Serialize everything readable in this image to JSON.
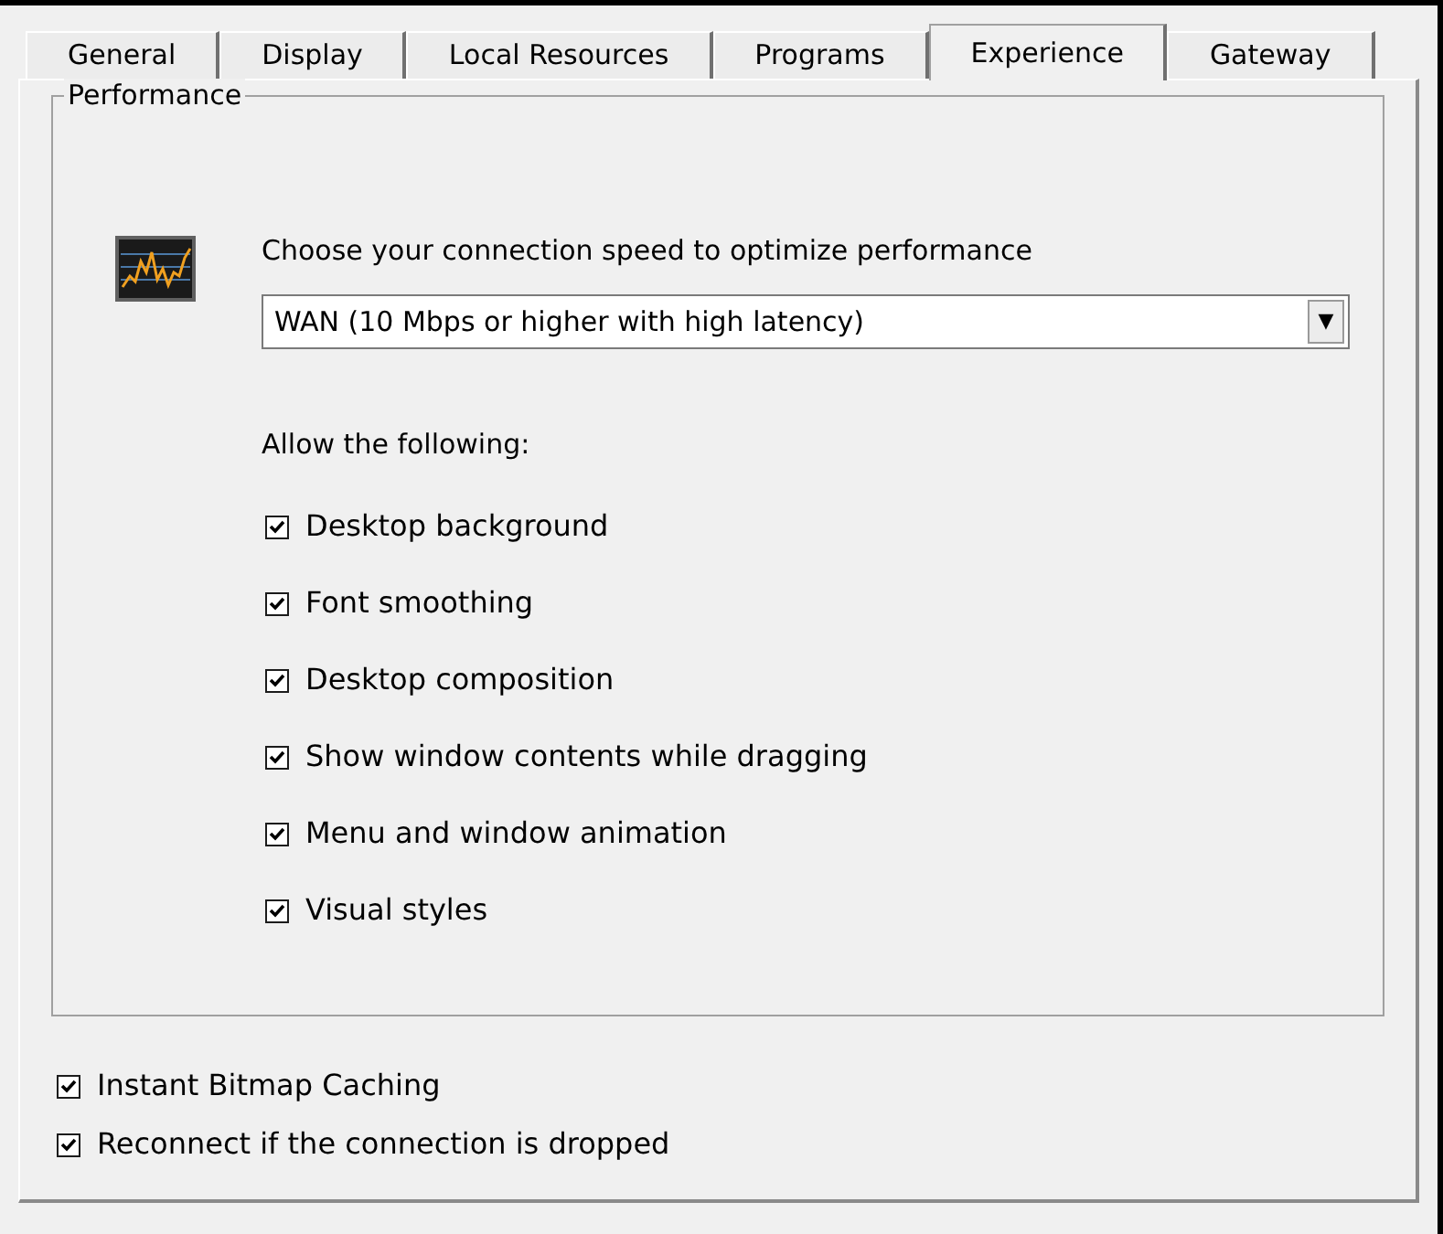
{
  "tabs": [
    {
      "label": "General",
      "selected": false
    },
    {
      "label": "Display",
      "selected": false
    },
    {
      "label": "Local Resources",
      "selected": false
    },
    {
      "label": "Programs",
      "selected": false
    },
    {
      "label": "Experience",
      "selected": true
    },
    {
      "label": "Gateway",
      "selected": false
    }
  ],
  "performance": {
    "title": "Performance",
    "prompt": "Choose your connection speed to optimize performance",
    "speed": {
      "value": "WAN (10 Mbps or higher with high latency)",
      "arrow": "▼"
    },
    "allow_label": "Allow the following:",
    "options": [
      {
        "label": "Desktop background",
        "checked": true
      },
      {
        "label": "Font smoothing",
        "checked": true
      },
      {
        "label": "Desktop composition",
        "checked": true
      },
      {
        "label": "Show window contents while dragging",
        "checked": true
      },
      {
        "label": "Menu and window animation",
        "checked": true
      },
      {
        "label": "Visual styles",
        "checked": true
      }
    ]
  },
  "options": [
    {
      "label": "Instant Bitmap Caching",
      "checked": true
    },
    {
      "label": "Reconnect if the connection is dropped",
      "checked": true
    }
  ]
}
